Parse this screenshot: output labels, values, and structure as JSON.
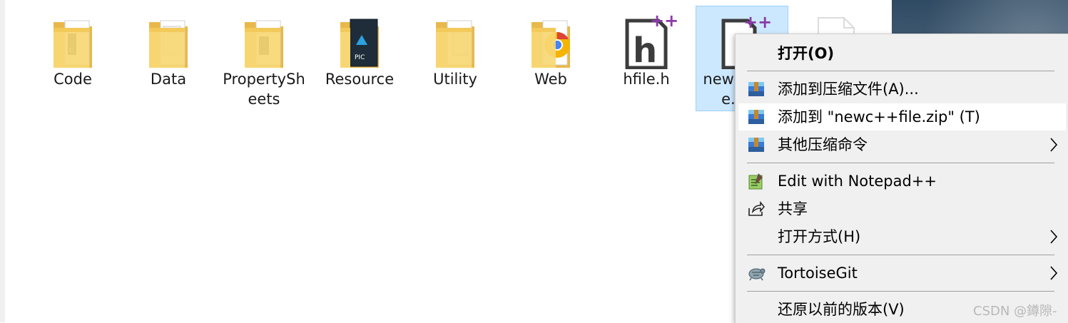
{
  "files": [
    {
      "label": "Code"
    },
    {
      "label": "Data"
    },
    {
      "label": "PropertySheets"
    },
    {
      "label": "Resource"
    },
    {
      "label": "Utility"
    },
    {
      "label": "Web"
    },
    {
      "label": "hfile.h"
    },
    {
      "label": "newc++file.cpp"
    }
  ],
  "context_menu": {
    "open": "打开(O)",
    "add_archive": "添加到压缩文件(A)...",
    "add_zip": "添加到 \"newc++file.zip\" (T)",
    "other_compress": "其他压缩命令",
    "notepad": "Edit with Notepad++",
    "share": "共享",
    "open_with": "打开方式(H)",
    "tortoisegit": "TortoiseGit",
    "restore": "还原以前的版本(V)"
  },
  "watermark": "CSDN @鐏隙-",
  "colors": {
    "selection_bg": "#cce8ff",
    "selection_border": "#99d1ff",
    "menu_bg": "#f0f0f0",
    "folder": "#f7d774",
    "npp_plus": "#8b3aa8"
  }
}
